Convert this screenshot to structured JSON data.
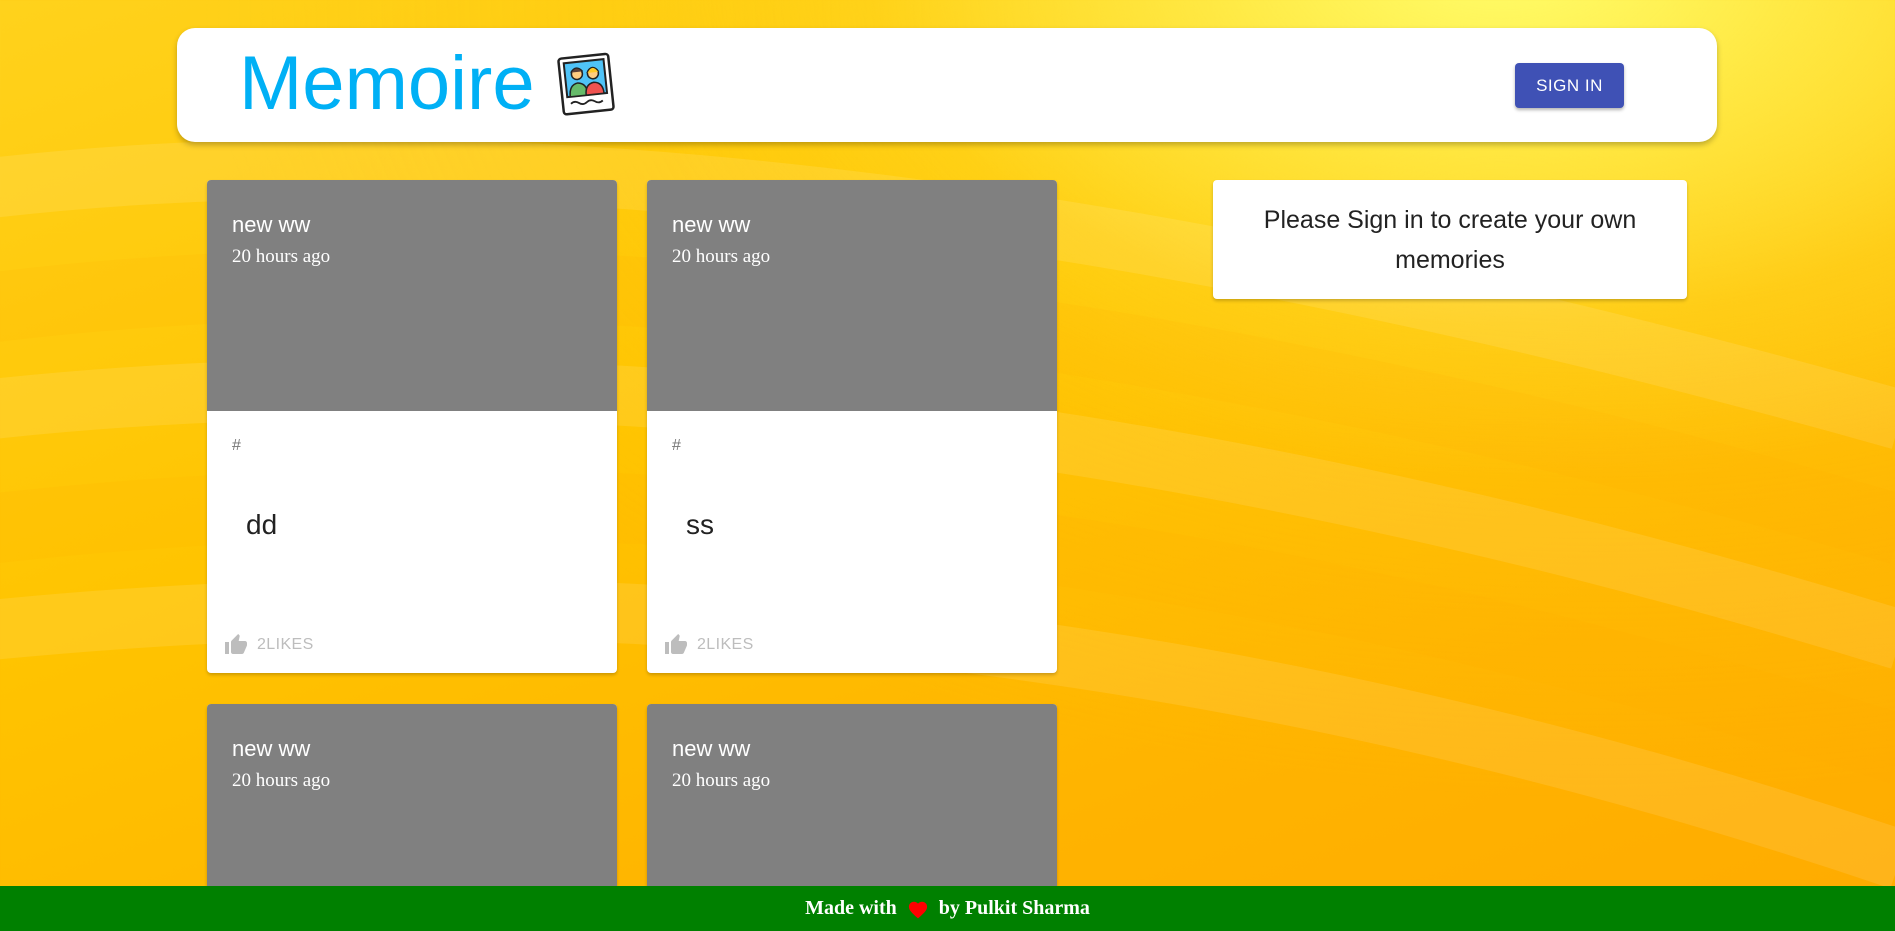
{
  "header": {
    "title": "Memoire",
    "logo_icon": "photo-frame-icon",
    "signin_label": "SIGN IN",
    "signin_color": "#3f51b5",
    "title_color": "#00b0f5"
  },
  "posts": [
    {
      "title": "new ww",
      "time": "20 hours ago",
      "tags": "#",
      "message": "dd",
      "likes": "2LIKES"
    },
    {
      "title": "new ww",
      "time": "20 hours ago",
      "tags": "#",
      "message": "ss",
      "likes": "2LIKES"
    },
    {
      "title": "new ww",
      "time": "20 hours ago"
    },
    {
      "title": "new ww",
      "time": "20 hours ago"
    }
  ],
  "notice": {
    "text": "Please Sign in to create your own memories"
  },
  "footer": {
    "prefix": "Made with",
    "heart_icon": "heart-icon",
    "suffix": "by Pulkit Sharma",
    "background": "#008000"
  }
}
